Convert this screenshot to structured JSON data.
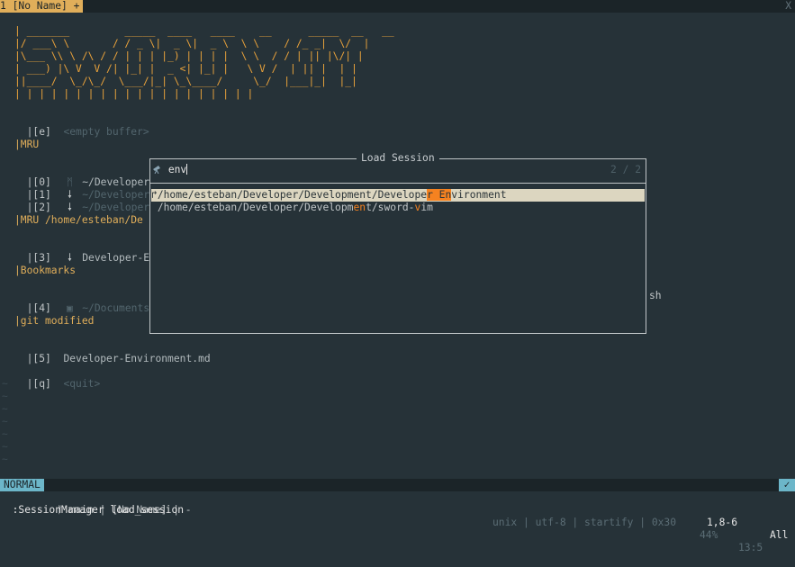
{
  "tabline": {
    "active_tab": "1 [No Name] +",
    "close": "X"
  },
  "banner": [
    "| _______         _____  ____   ____    __      _____  __   __",
    "|/ ___\\ \\       / / _ \\|  _ \\|  _ \\  \\ \\    / /_ _|  \\/  |",
    "|\\___ \\\\ \\ /\\ / / | | | |_) | | | |  \\ \\  / / | || |\\/| |",
    "| ___) |\\ V  V /| |_| |  _ <| |_| |   \\ V /  | || |  | |",
    "||____/  \\_/\\_/  \\___/|_| \\_\\____/     \\_/  |___|_|  |_|",
    "| | | | | | | | | | | | | | | | | | | |"
  ],
  "start": {
    "empty_key": "|[e]",
    "empty_label": "<empty buffer>",
    "mru_header": "|MRU",
    "mru_items": [
      {
        "key": "|[0]",
        "icon": "vim-icon",
        "glyph": "ᛗ",
        "path": "~/Developer/D"
      },
      {
        "key": "|[1]",
        "icon": "markdown-icon",
        "glyph": "🠗",
        "path": "~/Developer/D"
      },
      {
        "key": "|[2]",
        "icon": "markdown-icon",
        "glyph": "🠗",
        "path": "~/Developer/D"
      }
    ],
    "mru_cwd_header": "|MRU /home/esteban/De",
    "cwd_item": {
      "key": "|[3]",
      "icon": "markdown-icon",
      "glyph": "🠗",
      "path": "Developer-Env"
    },
    "bookmarks_header": "|Bookmarks",
    "bookmark_item": {
      "key": "|[4]",
      "icon": "file-icon",
      "glyph": "▣",
      "path": "~/Documents/F",
      "suffix": "sh"
    },
    "git_header": "|git modified",
    "git_item": {
      "key": "|[5]",
      "path": "Developer-Environment.md"
    },
    "quit_key": "|[q]",
    "quit_label": "<quit>"
  },
  "float": {
    "title": "Load Session",
    "prompt_icon": "telescope-icon",
    "query": "env",
    "counter": "2 / 2",
    "results": [
      {
        "pre": "/home/esteban/Developer/Development/Develope",
        "hl": "r En",
        "post": "vironment",
        "selected": true
      },
      {
        "pre": "/home/esteban/Developer/Developm",
        "m1": "en",
        "mid": "t/sword-",
        "m2": "v",
        "post": "im",
        "selected": false
      }
    ]
  },
  "statusline": {
    "mode": "NORMAL",
    "branch": "ᚠ main | [No Name] | -",
    "encoding": "unix | utf-8 | startify | 0x30",
    "percent": "44%",
    "position": "13:5",
    "check": "✓"
  },
  "cmdline": {
    "text": ":SessionManager load_session",
    "ruler": "1,8-6",
    "scroll": "All"
  },
  "colors": {
    "accent": "#e0ae5a",
    "banner": "#e9a23b",
    "mode": "#6cb6c9",
    "match": "#f58220",
    "bg": "#263238"
  }
}
